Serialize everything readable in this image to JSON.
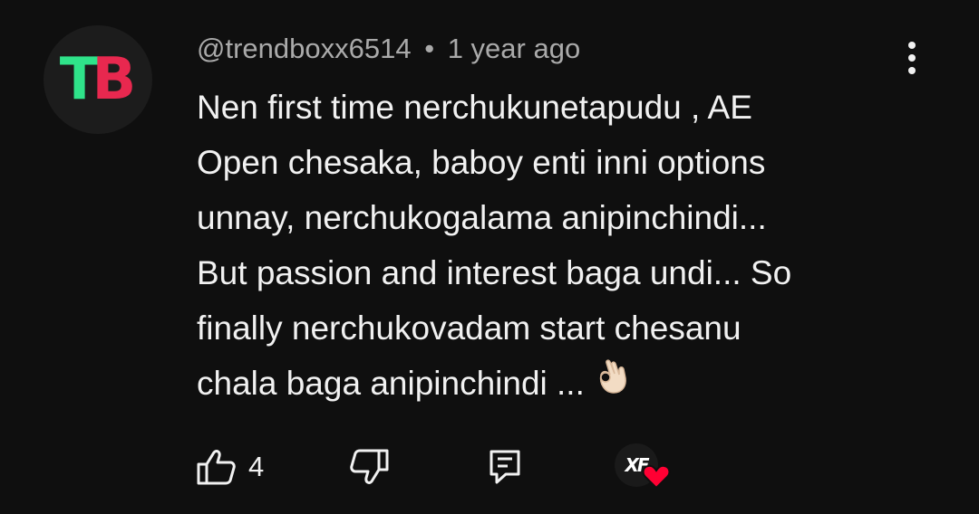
{
  "comment": {
    "avatar": {
      "letter_1": "T",
      "letter_2": "B",
      "colors": {
        "t": "#2fe38a",
        "b": "#e8284f"
      }
    },
    "username": "@trendboxx6514",
    "separator": "•",
    "timestamp": "1 year ago",
    "more_icon": "vertical-dots-icon",
    "lines": [
      "Nen first time nerchukunetapudu , AE",
      "Open chesaka, baboy enti inni options",
      "unnay, nerchukogalama anipinchindi...",
      "But passion and interest baga undi... So",
      "finally nerchukovadam start chesanu",
      "chala baga anipinchindi ..."
    ],
    "emoji": "ok-hand-emoji"
  },
  "actions": {
    "like_icon": "thumbs-up-icon",
    "like_count": "4",
    "dislike_icon": "thumbs-down-icon",
    "reply_icon": "reply-comment-icon",
    "creator_heart": {
      "avatar_text": "XF",
      "heart_color": "#ff0033"
    }
  }
}
